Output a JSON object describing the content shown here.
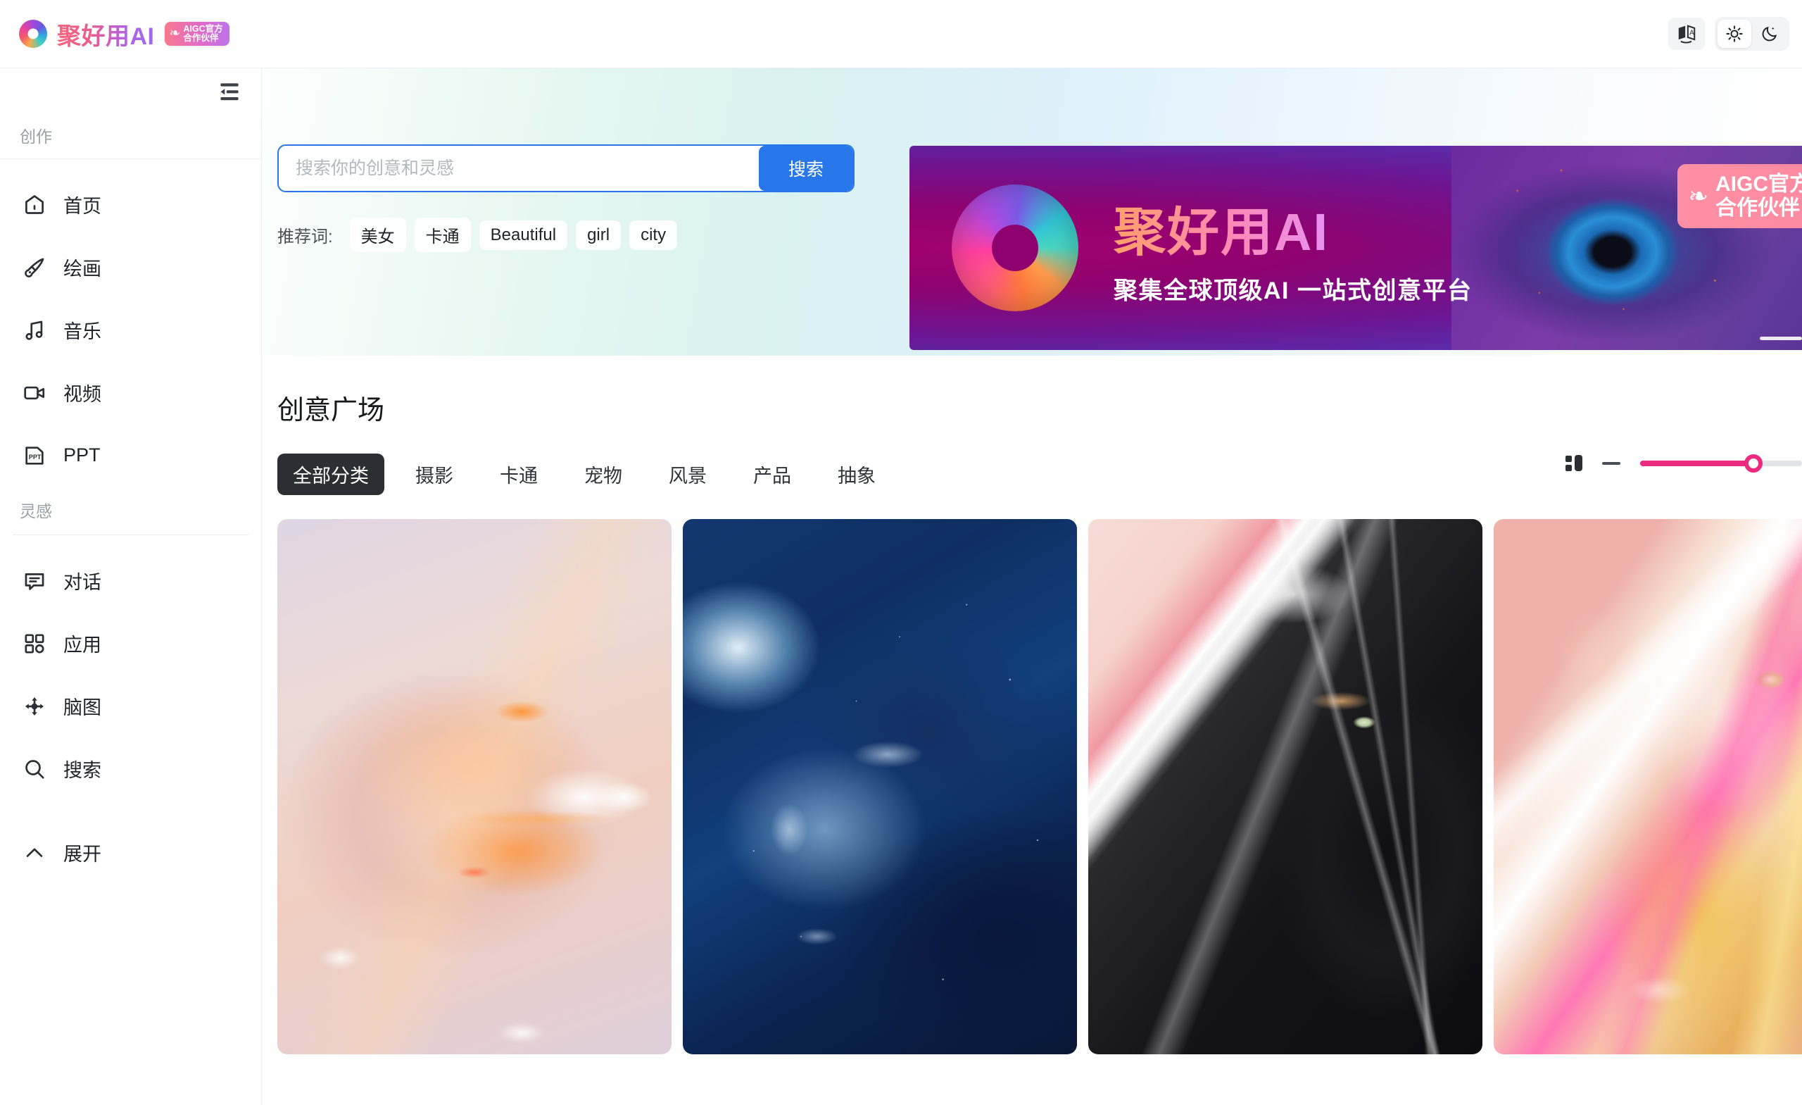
{
  "header": {
    "logo_text": "聚好用AI",
    "badge_line1": "AIGC官方",
    "badge_line2": "合作伙伴",
    "wreath": "❧",
    "translate_icon": "translate-icon",
    "light_icon": "☀",
    "dark_icon": "☽"
  },
  "sidebar": {
    "collapse_icon": "collapse-menu-icon",
    "section_create": "创作",
    "section_inspiration": "灵感",
    "create_items": [
      {
        "label": "首页",
        "icon": "home-icon"
      },
      {
        "label": "绘画",
        "icon": "brush-icon"
      },
      {
        "label": "音乐",
        "icon": "music-note-icon"
      },
      {
        "label": "视频",
        "icon": "video-camera-icon"
      },
      {
        "label": "PPT",
        "icon": "ppt-file-icon"
      }
    ],
    "inspiration_items": [
      {
        "label": "对话",
        "icon": "chat-bubble-icon"
      },
      {
        "label": "应用",
        "icon": "apps-grid-icon"
      },
      {
        "label": "脑图",
        "icon": "mindmap-icon"
      },
      {
        "label": "搜索",
        "icon": "search-icon"
      }
    ],
    "expand": {
      "label": "展开",
      "icon": "chevron-up-icon"
    }
  },
  "search": {
    "placeholder": "搜索你的创意和灵感",
    "value": "",
    "button_label": "搜索",
    "recommend_label": "推荐词:",
    "chips": [
      "美女",
      "卡通",
      "Beautiful",
      "girl",
      "city"
    ]
  },
  "banner": {
    "title": "聚好用AI",
    "subtitle": "聚集全球顶级AI 一站式创意平台",
    "badge_line1": "AIGC官方",
    "badge_line2": "合作伙伴",
    "wreath": "❧"
  },
  "plaza": {
    "title": "创意广场",
    "tabs": [
      {
        "label": "全部分类",
        "active": true
      },
      {
        "label": "摄影",
        "active": false
      },
      {
        "label": "卡通",
        "active": false
      },
      {
        "label": "宠物",
        "active": false
      },
      {
        "label": "风景",
        "active": false
      },
      {
        "label": "产品",
        "active": false
      },
      {
        "label": "抽象",
        "active": false
      }
    ],
    "controls": {
      "layout_icon": "layout-grid-icon",
      "zoom_out_icon": "minus-icon",
      "slider_value": 70,
      "accent_color": "#ec2a7f"
    },
    "cards": [
      {
        "name": "portrait-warm-light-flowers"
      },
      {
        "name": "blue-nebula-face"
      },
      {
        "name": "glossy-black-cat"
      },
      {
        "name": "chrome-iridescent-cat"
      }
    ]
  }
}
